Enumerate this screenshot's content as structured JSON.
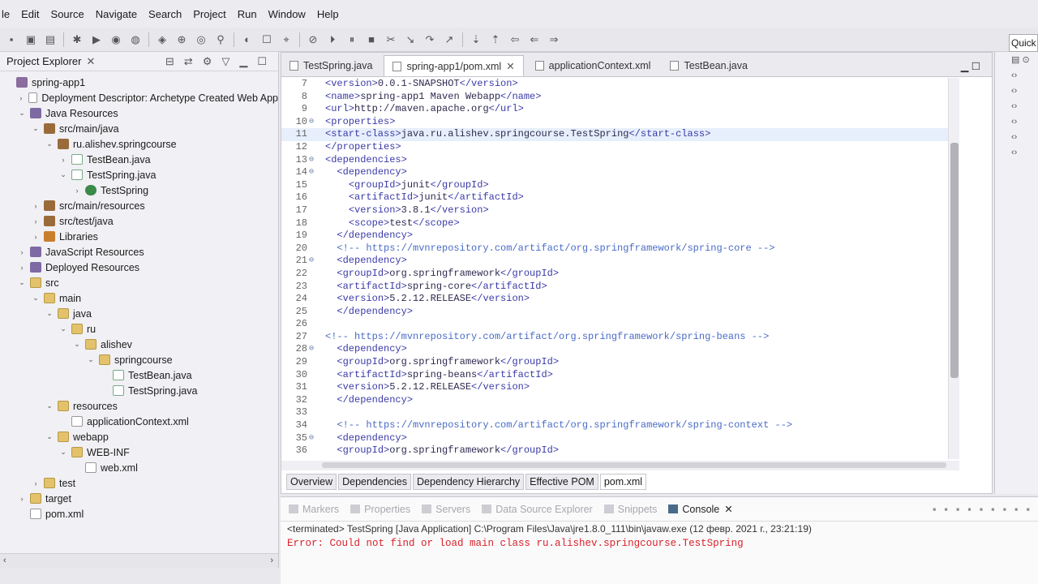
{
  "menu": [
    "le",
    "Edit",
    "Source",
    "Navigate",
    "Search",
    "Project",
    "Run",
    "Window",
    "Help"
  ],
  "quick_access": "Quick",
  "explorer": {
    "title": "Project Explorer",
    "tree": [
      {
        "label": "spring-app1",
        "indent": 0,
        "tw": "",
        "icon": "proj"
      },
      {
        "label": "Deployment Descriptor: Archetype Created Web App",
        "indent": 1,
        "tw": "›",
        "icon": "xml"
      },
      {
        "label": "Java Resources",
        "indent": 1,
        "tw": "⌄",
        "icon": "jar"
      },
      {
        "label": "src/main/java",
        "indent": 2,
        "tw": "⌄",
        "icon": "pkg"
      },
      {
        "label": "ru.alishev.springcourse",
        "indent": 3,
        "tw": "⌄",
        "icon": "pkg"
      },
      {
        "label": "TestBean.java",
        "indent": 4,
        "tw": "›",
        "icon": "java"
      },
      {
        "label": "TestSpring.java",
        "indent": 4,
        "tw": "⌄",
        "icon": "java"
      },
      {
        "label": "TestSpring",
        "indent": 5,
        "tw": "›",
        "icon": "cls"
      },
      {
        "label": "src/main/resources",
        "indent": 2,
        "tw": "›",
        "icon": "pkg"
      },
      {
        "label": "src/test/java",
        "indent": 2,
        "tw": "›",
        "icon": "pkg"
      },
      {
        "label": "Libraries",
        "indent": 2,
        "tw": "›",
        "icon": "lib"
      },
      {
        "label": "JavaScript Resources",
        "indent": 1,
        "tw": "›",
        "icon": "jar"
      },
      {
        "label": "Deployed Resources",
        "indent": 1,
        "tw": "›",
        "icon": "jar"
      },
      {
        "label": "src",
        "indent": 1,
        "tw": "⌄",
        "icon": "fold"
      },
      {
        "label": "main",
        "indent": 2,
        "tw": "⌄",
        "icon": "fold"
      },
      {
        "label": "java",
        "indent": 3,
        "tw": "⌄",
        "icon": "fold"
      },
      {
        "label": "ru",
        "indent": 4,
        "tw": "⌄",
        "icon": "fold"
      },
      {
        "label": "alishev",
        "indent": 5,
        "tw": "⌄",
        "icon": "fold"
      },
      {
        "label": "springcourse",
        "indent": 6,
        "tw": "⌄",
        "icon": "fold"
      },
      {
        "label": "TestBean.java",
        "indent": 7,
        "tw": "",
        "icon": "java"
      },
      {
        "label": "TestSpring.java",
        "indent": 7,
        "tw": "",
        "icon": "java"
      },
      {
        "label": "resources",
        "indent": 3,
        "tw": "⌄",
        "icon": "fold"
      },
      {
        "label": "applicationContext.xml",
        "indent": 4,
        "tw": "",
        "icon": "xml"
      },
      {
        "label": "webapp",
        "indent": 3,
        "tw": "⌄",
        "icon": "fold"
      },
      {
        "label": "WEB-INF",
        "indent": 4,
        "tw": "⌄",
        "icon": "fold"
      },
      {
        "label": "web.xml",
        "indent": 5,
        "tw": "",
        "icon": "xml"
      },
      {
        "label": "test",
        "indent": 2,
        "tw": "›",
        "icon": "fold"
      },
      {
        "label": "target",
        "indent": 1,
        "tw": "›",
        "icon": "fold"
      },
      {
        "label": "pom.xml",
        "indent": 1,
        "tw": "",
        "icon": "xml"
      }
    ]
  },
  "editor": {
    "tabs": [
      {
        "label": "TestSpring.java",
        "active": false,
        "close": ""
      },
      {
        "label": "spring-app1/pom.xml",
        "active": true,
        "close": "✕"
      },
      {
        "label": "applicationContext.xml",
        "active": false,
        "close": ""
      },
      {
        "label": "TestBean.java",
        "active": false,
        "close": ""
      }
    ],
    "lines": [
      {
        "num": "7",
        "mark": "",
        "text": "<version>0.0.1-SNAPSHOT</version>",
        "hl": false
      },
      {
        "num": "8",
        "mark": "",
        "text": "<name>spring-app1 Maven Webapp</name>",
        "hl": false
      },
      {
        "num": "9",
        "mark": "",
        "text": "<url>http://maven.apache.org</url>",
        "hl": false
      },
      {
        "num": "10",
        "mark": "⊖",
        "text": "<properties>",
        "hl": false
      },
      {
        "num": "11",
        "mark": "",
        "text": "<start-class>java.ru.alishev.springcourse.TestSpring</start-class>",
        "hl": true
      },
      {
        "num": "12",
        "mark": "",
        "text": "</properties>",
        "hl": false
      },
      {
        "num": "13",
        "mark": "⊖",
        "text": "<dependencies>",
        "hl": false
      },
      {
        "num": "14",
        "mark": "⊖",
        "text": "  <dependency>",
        "hl": false
      },
      {
        "num": "15",
        "mark": "",
        "text": "    <groupId>junit</groupId>",
        "hl": false
      },
      {
        "num": "16",
        "mark": "",
        "text": "    <artifactId>junit</artifactId>",
        "hl": false
      },
      {
        "num": "17",
        "mark": "",
        "text": "    <version>3.8.1</version>",
        "hl": false
      },
      {
        "num": "18",
        "mark": "",
        "text": "    <scope>test</scope>",
        "hl": false
      },
      {
        "num": "19",
        "mark": "",
        "text": "  </dependency>",
        "hl": false
      },
      {
        "num": "20",
        "mark": "",
        "text": "  <!-- https://mvnrepository.com/artifact/org.springframework/spring-core -->",
        "hl": false
      },
      {
        "num": "21",
        "mark": "⊖",
        "text": "  <dependency>",
        "hl": false
      },
      {
        "num": "22",
        "mark": "",
        "text": "  <groupId>org.springframework</groupId>",
        "hl": false
      },
      {
        "num": "23",
        "mark": "",
        "text": "  <artifactId>spring-core</artifactId>",
        "hl": false
      },
      {
        "num": "24",
        "mark": "",
        "text": "  <version>5.2.12.RELEASE</version>",
        "hl": false
      },
      {
        "num": "25",
        "mark": "",
        "text": "  </dependency>",
        "hl": false
      },
      {
        "num": "26",
        "mark": "",
        "text": "",
        "hl": false
      },
      {
        "num": "27",
        "mark": "",
        "text": "<!-- https://mvnrepository.com/artifact/org.springframework/spring-beans -->",
        "hl": false
      },
      {
        "num": "28",
        "mark": "⊖",
        "text": "  <dependency>",
        "hl": false
      },
      {
        "num": "29",
        "mark": "",
        "text": "  <groupId>org.springframework</groupId>",
        "hl": false
      },
      {
        "num": "30",
        "mark": "",
        "text": "  <artifactId>spring-beans</artifactId>",
        "hl": false
      },
      {
        "num": "31",
        "mark": "",
        "text": "  <version>5.2.12.RELEASE</version>",
        "hl": false
      },
      {
        "num": "32",
        "mark": "",
        "text": "  </dependency>",
        "hl": false
      },
      {
        "num": "33",
        "mark": "",
        "text": "",
        "hl": false
      },
      {
        "num": "34",
        "mark": "",
        "text": "  <!-- https://mvnrepository.com/artifact/org.springframework/spring-context -->",
        "hl": false
      },
      {
        "num": "35",
        "mark": "⊖",
        "text": "  <dependency>",
        "hl": false
      },
      {
        "num": "36",
        "mark": "",
        "text": "  <groupId>org.springframework</groupId>",
        "hl": false
      }
    ],
    "pom_tabs": [
      {
        "label": "Overview",
        "active": false
      },
      {
        "label": "Dependencies",
        "active": false
      },
      {
        "label": "Dependency Hierarchy",
        "active": false
      },
      {
        "label": "Effective POM",
        "active": false
      },
      {
        "label": "pom.xml",
        "active": true
      }
    ]
  },
  "console": {
    "tabs": [
      {
        "label": "Markers",
        "active": false
      },
      {
        "label": "Properties",
        "active": false
      },
      {
        "label": "Servers",
        "active": false
      },
      {
        "label": "Data Source Explorer",
        "active": false
      },
      {
        "label": "Snippets",
        "active": false
      },
      {
        "label": "Console",
        "active": true
      }
    ],
    "terminated": "<terminated> TestSpring [Java Application] C:\\Program Files\\Java\\jre1.8.0_111\\bin\\javaw.exe (12 февр. 2021 г., 23:21:19)",
    "error": "Error: Could not find or load main class ru.alishev.springcourse.TestSpring"
  },
  "colors": {
    "tag": "#3a3aa8",
    "comment": "#4a6cc8",
    "error": "#d8232a",
    "highlight": "#e6effb"
  }
}
